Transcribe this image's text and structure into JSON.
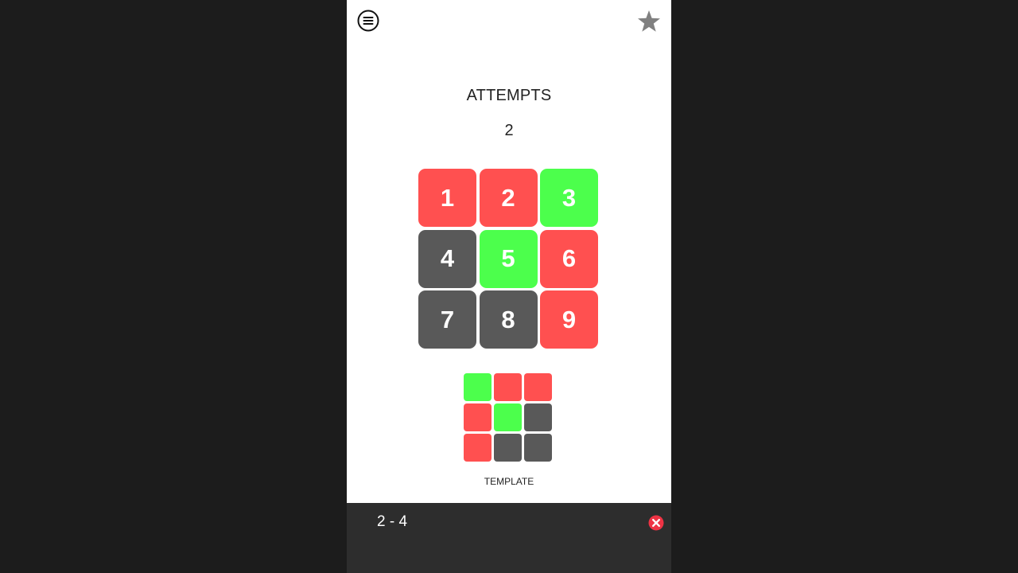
{
  "colors": {
    "red": "#ff5050",
    "green": "#4cff4c",
    "gray": "#595959",
    "frame": "#1c1c1c",
    "bar": "#2d2d2d",
    "close": "#ee3344"
  },
  "header": {
    "menu_icon": "menu-circle-icon",
    "favorite_icon": "star-icon"
  },
  "attempts": {
    "label": "ATTEMPTS",
    "value": "2"
  },
  "board": {
    "tiles": [
      {
        "label": "1",
        "state": "red"
      },
      {
        "label": "2",
        "state": "red"
      },
      {
        "label": "3",
        "state": "green"
      },
      {
        "label": "4",
        "state": "gray"
      },
      {
        "label": "5",
        "state": "green"
      },
      {
        "label": "6",
        "state": "red"
      },
      {
        "label": "7",
        "state": "gray"
      },
      {
        "label": "8",
        "state": "gray"
      },
      {
        "label": "9",
        "state": "red"
      }
    ]
  },
  "template": {
    "label": "TEMPLATE",
    "cells": [
      "green",
      "red",
      "red",
      "red",
      "green",
      "gray",
      "red",
      "gray",
      "gray"
    ]
  },
  "bottom_bar": {
    "text": "2 - 4",
    "close_icon": "close-circle-icon"
  }
}
